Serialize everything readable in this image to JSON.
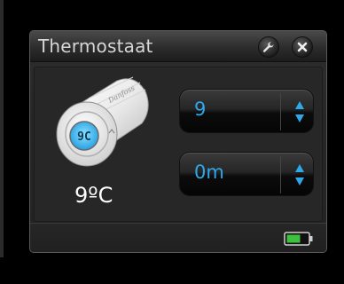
{
  "window": {
    "title": "Thermostaat"
  },
  "titlebar": {
    "settings_icon": "wrench-icon",
    "close_icon": "close-icon"
  },
  "device": {
    "brand": "Danfoss",
    "display_text": "9C",
    "temperature_label": "9ºC"
  },
  "controls": {
    "setpoint": {
      "value": "9"
    },
    "duration": {
      "value": "0m"
    }
  },
  "status": {
    "battery_icon": "battery-icon",
    "battery_color": "#3cc23c"
  },
  "colors": {
    "accent": "#2ea8ea"
  }
}
